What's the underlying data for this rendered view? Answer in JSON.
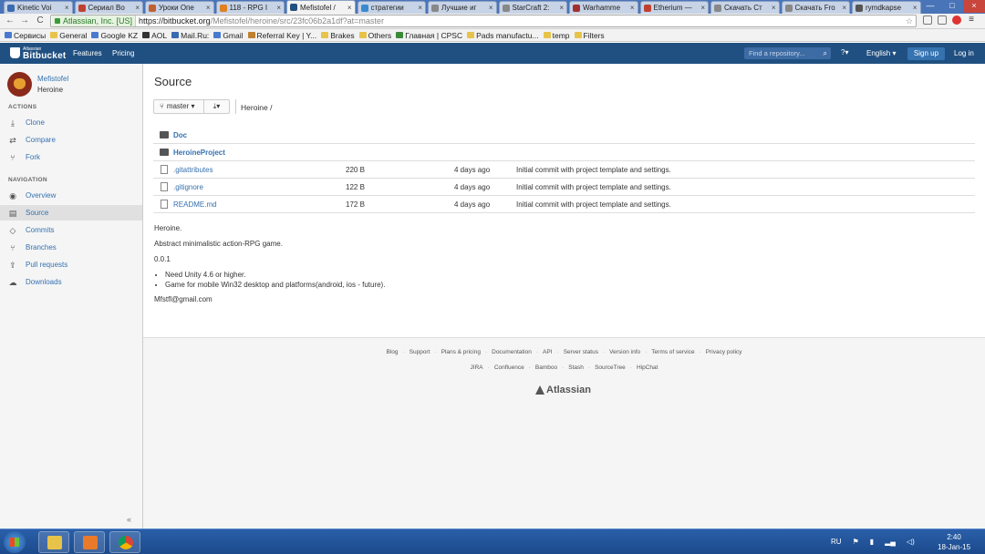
{
  "browser": {
    "tabs": [
      {
        "label": "Kinetic Voi",
        "color": "#3a6ab0"
      },
      {
        "label": "Сериал Во",
        "color": "#c04030"
      },
      {
        "label": "Уроки Опе",
        "color": "#c06030"
      },
      {
        "label": "118 - RPG I",
        "color": "#e08020"
      },
      {
        "label": "Mefistofel /",
        "color": "#205081"
      },
      {
        "label": "стратегии",
        "color": "#3a8ad0"
      },
      {
        "label": "Лучшие иг",
        "color": "#888888"
      },
      {
        "label": "StarCraft 2:",
        "color": "#888888"
      },
      {
        "label": "Warhamme",
        "color": "#a03030"
      },
      {
        "label": "Etherium —",
        "color": "#c04030"
      },
      {
        "label": "Скачать Ст",
        "color": "#888888"
      },
      {
        "label": "Скачать Fro",
        "color": "#888888"
      },
      {
        "label": "rymdkapse",
        "color": "#555555"
      }
    ],
    "tab_close": "×",
    "win_controls": [
      "—",
      "□",
      "×"
    ],
    "back": "←",
    "forward": "→",
    "reload": "C",
    "secure_label": "Atlassian, Inc. [US]",
    "url_host": "https://bitbucket.org",
    "url_path": "/Mefistofel/heroine/src/23fc06b2a1df?at=master",
    "star": "☆",
    "bookmarks": [
      {
        "label": "Сервисы",
        "color": "#4a7ad0"
      },
      {
        "label": "General",
        "color": "#e8c34a"
      },
      {
        "label": "Google KZ",
        "color": "#4a7ad0"
      },
      {
        "label": "AOL",
        "color": "#333333"
      },
      {
        "label": "Mail.Ru:",
        "color": "#3a6ab0"
      },
      {
        "label": "Gmail",
        "color": "#4a7ad0"
      },
      {
        "label": "Referral Key | Y...",
        "color": "#c08030"
      },
      {
        "label": "Brakes",
        "color": "#e8c34a"
      },
      {
        "label": "Others",
        "color": "#e8c34a"
      },
      {
        "label": "Главная | CPSC",
        "color": "#3a8a3a"
      },
      {
        "label": "Pads manufactu...",
        "color": "#e8c34a"
      },
      {
        "label": "temp",
        "color": "#e8c34a"
      },
      {
        "label": "Filters",
        "color": "#e8c34a"
      }
    ]
  },
  "header": {
    "logo_small": "Atlassian",
    "logo_big": "Bitbucket",
    "nav": [
      "Features",
      "Pricing"
    ],
    "search_placeholder": "Find a repository...",
    "search_icon": "⌕",
    "help_icon": "?▾",
    "language": "English ▾",
    "signup": "Sign up",
    "login": "Log in"
  },
  "sidebar": {
    "owner": "Mefistofel",
    "repo": "Heroine",
    "actions_heading": "ACTIONS",
    "actions": [
      {
        "label": "Clone",
        "icon": "⤓"
      },
      {
        "label": "Compare",
        "icon": "⇄"
      },
      {
        "label": "Fork",
        "icon": "⑂"
      }
    ],
    "navigation_heading": "NAVIGATION",
    "navigation": [
      {
        "label": "Overview",
        "icon": "◉"
      },
      {
        "label": "Source",
        "icon": "▤"
      },
      {
        "label": "Commits",
        "icon": "◇"
      },
      {
        "label": "Branches",
        "icon": "⑂"
      },
      {
        "label": "Pull requests",
        "icon": "⇪"
      },
      {
        "label": "Downloads",
        "icon": "☁"
      }
    ],
    "active": "Source",
    "collapse": "«"
  },
  "main": {
    "title": "Source",
    "branch": "master ▾",
    "download": "⤓▾",
    "breadcrumb": "Heroine /",
    "files": [
      {
        "type": "dir",
        "name": "Doc",
        "size": "",
        "age": "",
        "message": ""
      },
      {
        "type": "dir",
        "name": "HeroineProject",
        "size": "",
        "age": "",
        "message": ""
      },
      {
        "type": "file",
        "name": ".gitattributes",
        "size": "220 B",
        "age": "4 days ago",
        "message": "Initial commit with project template and settings."
      },
      {
        "type": "file",
        "name": ".gitignore",
        "size": "122 B",
        "age": "4 days ago",
        "message": "Initial commit with project template and settings."
      },
      {
        "type": "file",
        "name": "README.md",
        "size": "172 B",
        "age": "4 days ago",
        "message": "Initial commit with project template and settings."
      }
    ],
    "readme": {
      "title": "Heroine.",
      "description": "Abstract minimalistic action-RPG game.",
      "version": "0.0.1",
      "bullets": [
        "Need Unity 4.6 or higher.",
        "Game for mobile Win32 desktop and platforms(android, ios - future)."
      ],
      "email": "Mfstfl@gmail.com"
    }
  },
  "footer": {
    "links1": [
      "Blog",
      "Support",
      "Plans & pricing",
      "Documentation",
      "API",
      "Server status",
      "Version info",
      "Terms of service",
      "Privacy policy"
    ],
    "links2": [
      "JIRA",
      "Confluence",
      "Bamboo",
      "Stash",
      "SourceTree",
      "HipChat"
    ],
    "brand": "Atlassian"
  },
  "taskbar": {
    "apps": [
      {
        "name": "explorer",
        "color": "#e8c34a"
      },
      {
        "name": "media-player",
        "color": "#e87a2a"
      },
      {
        "name": "chrome",
        "color": "#4a9a3a"
      }
    ],
    "lang": "RU",
    "time": "2:40",
    "date": "18-Jan-15"
  }
}
